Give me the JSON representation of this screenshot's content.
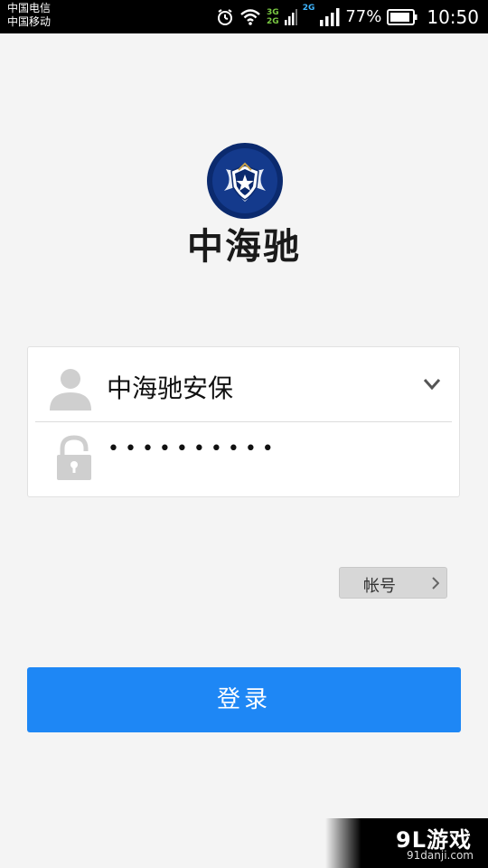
{
  "status_bar": {
    "carriers": [
      "中国电信",
      "中国移动"
    ],
    "network_3g": "3G",
    "network_2g_a": "2G",
    "network_2g_b": "2G",
    "battery_percent": "77%",
    "time": "10:50",
    "icons": [
      "alarm-icon",
      "wifi-icon",
      "signal-icon",
      "battery-icon"
    ]
  },
  "brand": {
    "title": "中海驰",
    "logo_icon": "shield-star-logo",
    "logo_colors": {
      "outer": "#0b2a6e",
      "inner": "#ffffff",
      "accent": "#c9a24a"
    }
  },
  "login_form": {
    "username": "中海驰安保",
    "password_mask": "••••••••••",
    "user_icon": "user-icon",
    "lock_icon": "lock-icon",
    "dropdown_icon": "chevron-down-icon"
  },
  "account_button": {
    "label": "帐号",
    "icon": "chevron-right-icon"
  },
  "login_button": {
    "label": "登录",
    "color": "#1e87f5"
  },
  "watermark": {
    "main": "9L游戏",
    "sub": "91danji.com"
  }
}
